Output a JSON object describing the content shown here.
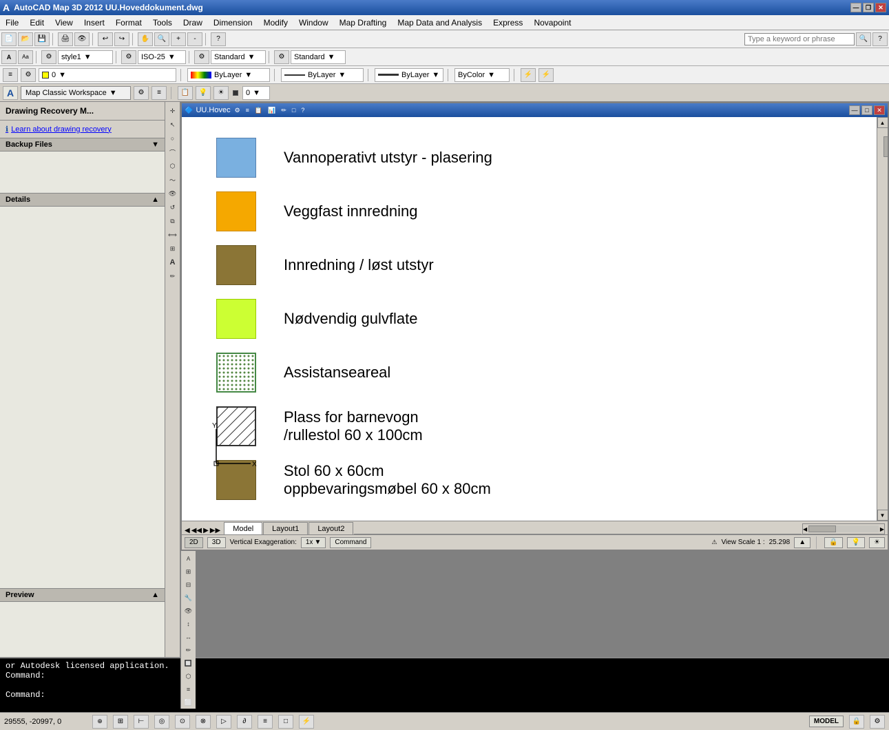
{
  "app": {
    "title": "AutoCAD Map 3D 2012    UU.Hoveddokument.dwg",
    "logo": "AutoCAD",
    "search_placeholder": "Type a keyword or phrase"
  },
  "titlebar": {
    "minimize": "—",
    "maximize": "□",
    "restore": "❐",
    "close": "✕",
    "title_btns": [
      "—",
      "❐",
      "✕"
    ]
  },
  "menubar": {
    "items": [
      "File",
      "Edit",
      "View",
      "Insert",
      "Format",
      "Tools",
      "Draw",
      "Dimension",
      "Modify",
      "Window",
      "Map Drafting",
      "Map Data and Analysis",
      "Express",
      "Novapoint"
    ]
  },
  "workspace": {
    "name": "Map Classic Workspace",
    "settings_icon": "⚙",
    "layer_icon": "≡"
  },
  "drawing_window": {
    "title": "UU.Hovec",
    "min": "—",
    "max": "□",
    "close": "✕"
  },
  "left_panel": {
    "title": "Drawing Recovery M...",
    "info_link": "Learn about drawing recovery",
    "backup_section": "Backup Files",
    "details_section": "Details",
    "preview_section": "Preview"
  },
  "legend": {
    "items": [
      {
        "label": "Vannoperativt utstyr - plasering",
        "color": "#7ab0e0",
        "type": "solid"
      },
      {
        "label": "Veggfast innredning",
        "color": "#f5a800",
        "type": "solid"
      },
      {
        "label": "Innredning / løst utstyr",
        "color": "#8b7536",
        "type": "solid"
      },
      {
        "label": "Nødvendig gulvflate",
        "color": "#ccff33",
        "type": "solid"
      },
      {
        "label": "Assistanseareal",
        "color": "#88cc44",
        "type": "dotted"
      },
      {
        "label": "Plass for barnevogn\n/rullestol 60 x 100cm",
        "color": "white",
        "type": "hatched"
      },
      {
        "label": "Stol 60 x 60cm\noppbevaringsmøbel 60 x 80cm",
        "color": "#8b7536",
        "type": "solid"
      }
    ]
  },
  "tabs": {
    "model": "Model",
    "layout1": "Layout1",
    "layout2": "Layout2",
    "active": "Model"
  },
  "drawing_status": {
    "mode_2d": "2D",
    "mode_3d": "3D",
    "vert_exag_label": "Vertical Exaggeration:",
    "vert_exag_value": "1x",
    "command_btn": "Command",
    "view_scale_label": "View Scale 1 :",
    "view_scale_value": "25.298"
  },
  "command_area": {
    "lines": [
      "or Autodesk licensed application.",
      "Command:",
      "",
      "Command:"
    ]
  },
  "status_bar": {
    "coords": "29555, -20997, 0",
    "model_label": "MODEL"
  },
  "toolbar": {
    "style_label": "style1",
    "iso_label": "ISO-25",
    "standard1_label": "Standard",
    "standard2_label": "Standard",
    "bylayer1": "ByLayer",
    "bylayer2": "ByLayer",
    "bylayer3": "ByLayer",
    "bycolor": "ByColor",
    "layer_dropdown": "0"
  }
}
